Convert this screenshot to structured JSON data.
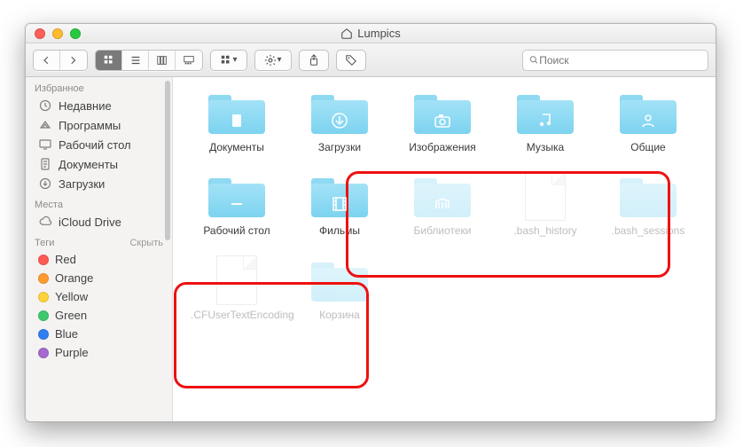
{
  "window": {
    "title": "Lumpics"
  },
  "toolbar": {
    "search_placeholder": "Поиск"
  },
  "sidebar": {
    "favorites_label": "Избранное",
    "favorites": [
      {
        "label": "Недавние",
        "icon": "recent"
      },
      {
        "label": "Программы",
        "icon": "apps"
      },
      {
        "label": "Рабочий стол",
        "icon": "desktop"
      },
      {
        "label": "Документы",
        "icon": "docs"
      },
      {
        "label": "Загрузки",
        "icon": "downloads"
      }
    ],
    "locations_label": "Места",
    "locations": [
      {
        "label": "iCloud Drive",
        "icon": "cloud"
      }
    ],
    "tags_label": "Теги",
    "tags_hide": "Скрыть",
    "tags": [
      {
        "label": "Red",
        "color": "#ff5a52"
      },
      {
        "label": "Orange",
        "color": "#ff9b2f"
      },
      {
        "label": "Yellow",
        "color": "#ffd33d"
      },
      {
        "label": "Green",
        "color": "#3fc96e"
      },
      {
        "label": "Blue",
        "color": "#2f7ff3"
      },
      {
        "label": "Purple",
        "color": "#a56ad0"
      }
    ]
  },
  "files": [
    {
      "label": "Документы",
      "kind": "folder",
      "glyph": "doc",
      "hidden": false
    },
    {
      "label": "Загрузки",
      "kind": "folder",
      "glyph": "download",
      "hidden": false
    },
    {
      "label": "Изображения",
      "kind": "folder",
      "glyph": "camera",
      "hidden": false
    },
    {
      "label": "Музыка",
      "kind": "folder",
      "glyph": "music",
      "hidden": false
    },
    {
      "label": "Общие",
      "kind": "folder",
      "glyph": "person",
      "hidden": false
    },
    {
      "label": "Рабочий стол",
      "kind": "folder",
      "glyph": "minus",
      "hidden": false
    },
    {
      "label": "Фильмы",
      "kind": "folder",
      "glyph": "film",
      "hidden": false
    },
    {
      "label": "Библиотеки",
      "kind": "folder",
      "glyph": "library",
      "hidden": true
    },
    {
      "label": ".bash_history",
      "kind": "file",
      "glyph": "",
      "hidden": true
    },
    {
      "label": ".bash_sessions",
      "kind": "folder",
      "glyph": "",
      "hidden": true
    },
    {
      "label": ".CFUserTextEncoding",
      "kind": "file",
      "glyph": "",
      "hidden": true
    },
    {
      "label": "Корзина",
      "kind": "folder",
      "glyph": "",
      "hidden": true
    }
  ]
}
